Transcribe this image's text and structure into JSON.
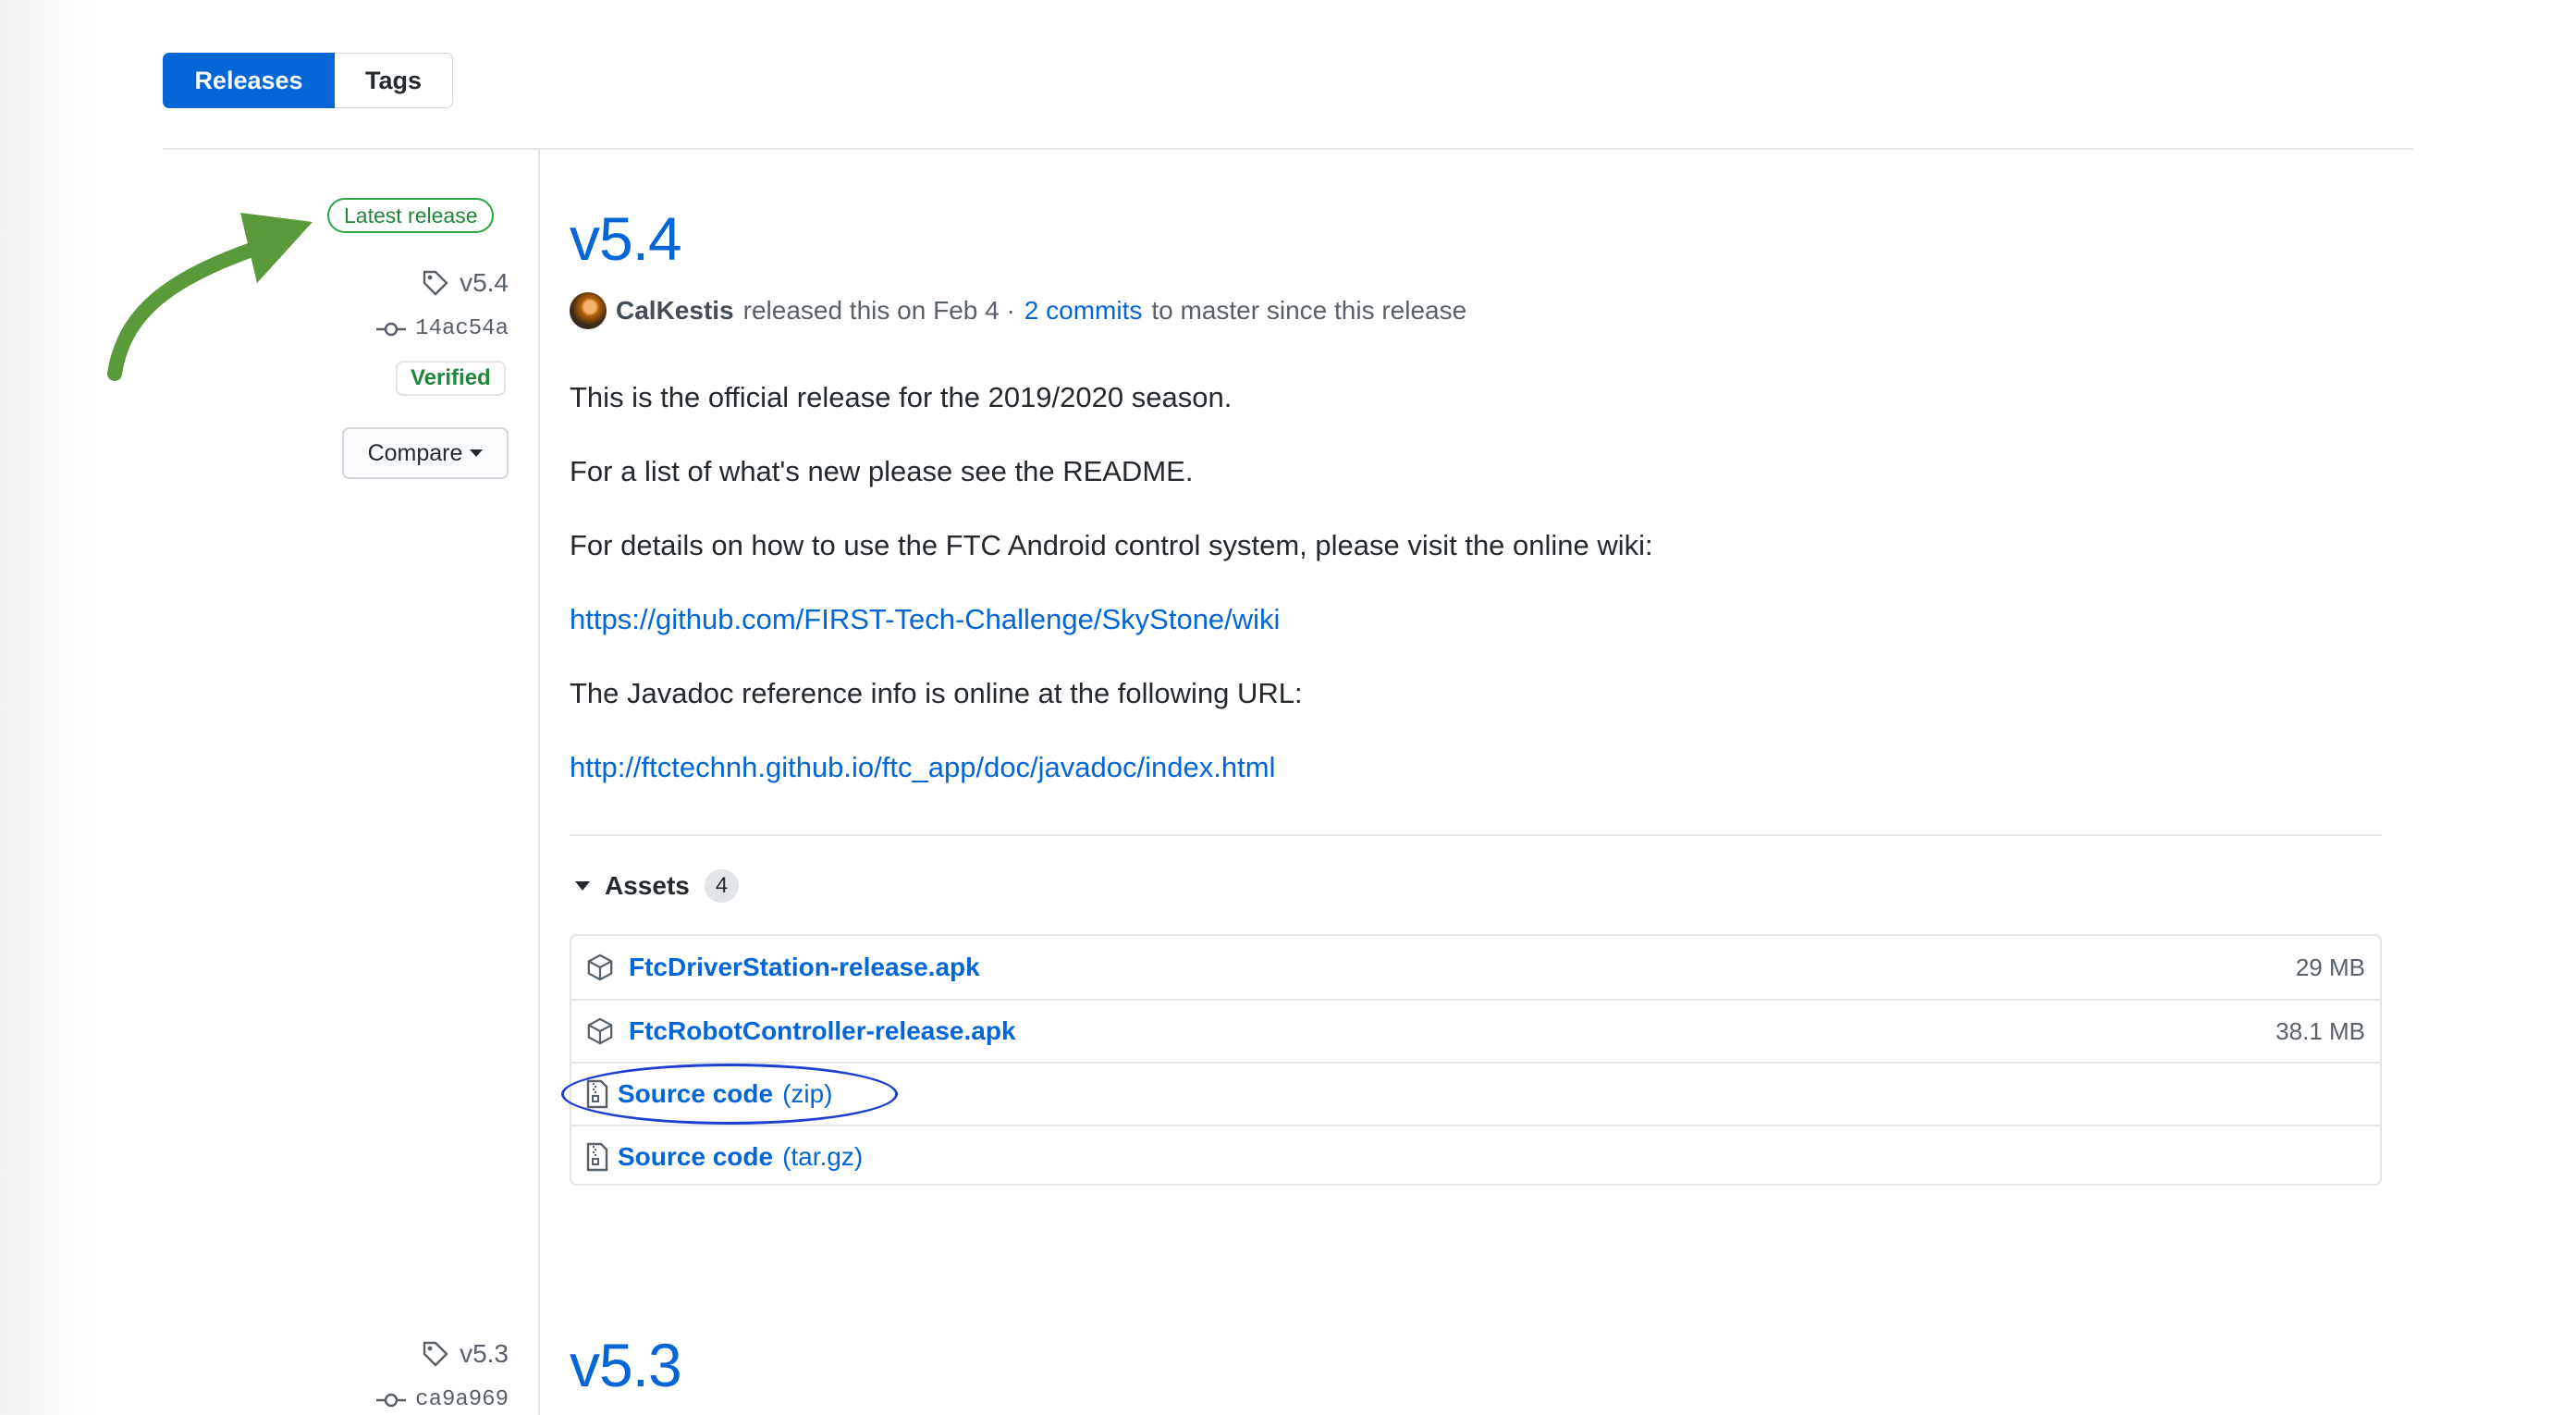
{
  "tabs": {
    "releases": "Releases",
    "tags": "Tags"
  },
  "release": {
    "latest_badge": "Latest release",
    "tag": "v5.4",
    "commit": "14ac54a",
    "verified": "Verified",
    "compare": "Compare",
    "title": "v5.4",
    "author": "CalKestis",
    "released_text": "released this on Feb 4 ·",
    "commits_link": "2 commits",
    "commits_suffix": "to master since this release",
    "body": {
      "line1": "This is the official release for the 2019/2020 season.",
      "line2": "For a list of what's new please see the README.",
      "line3": "For details on how to use the FTC Android control system, please visit the online wiki:",
      "link1": "https://github.com/FIRST-Tech-Challenge/SkyStone/wiki",
      "line4": "The Javadoc reference info is online at the following URL:",
      "link2": "http://ftctechnh.github.io/ftc_app/doc/javadoc/index.html"
    },
    "assets": {
      "label": "Assets",
      "count": "4",
      "items": [
        {
          "name": "FtcDriverStation-release.apk",
          "size": "29 MB",
          "icon": "package-icon"
        },
        {
          "name": "FtcRobotController-release.apk",
          "size": "38.1 MB",
          "icon": "package-icon"
        },
        {
          "name": "Source code",
          "ext": "(zip)",
          "icon": "file-zip-icon"
        },
        {
          "name": "Source code",
          "ext": "(tar.gz)",
          "icon": "file-zip-icon"
        }
      ]
    }
  },
  "next_release": {
    "tag": "v5.3",
    "commit": "ca9a969",
    "title": "v5.3"
  },
  "annotations": {
    "arrow_color": "#5a9a3a",
    "ellipse_color": "#1f3fcf"
  }
}
